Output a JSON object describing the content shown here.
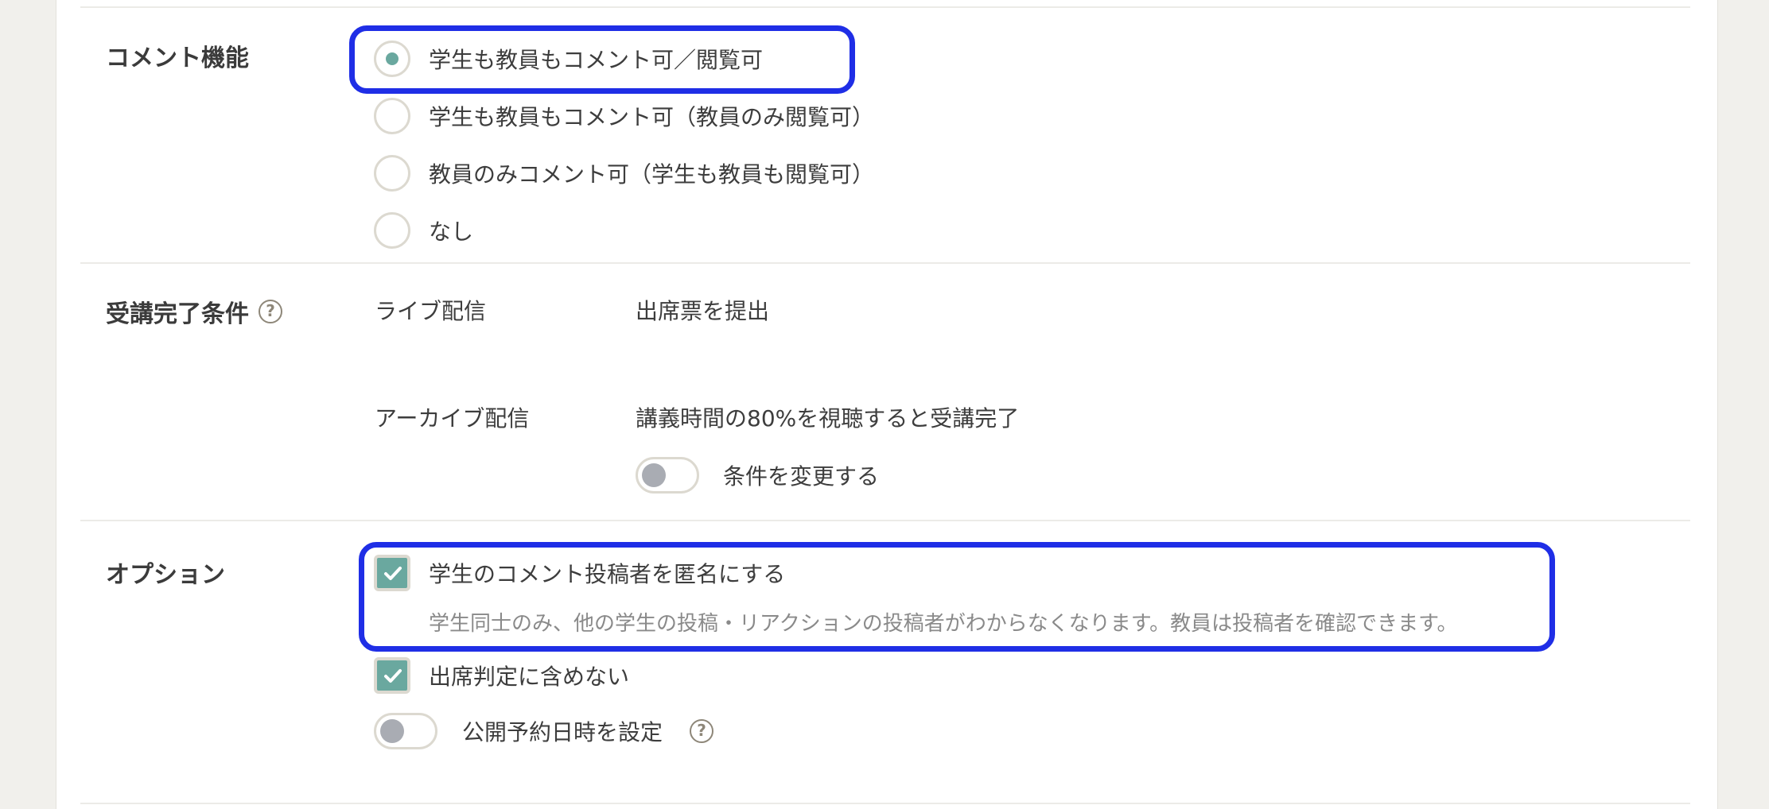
{
  "comment_section": {
    "title": "コメント機能",
    "options": [
      {
        "label": "学生も教員もコメント可／閲覧可",
        "checked": true
      },
      {
        "label": "学生も教員もコメント可（教員のみ閲覧可）",
        "checked": false
      },
      {
        "label": "教員のみコメント可（学生も教員も閲覧可）",
        "checked": false
      },
      {
        "label": "なし",
        "checked": false
      }
    ]
  },
  "completion_section": {
    "title": "受講完了条件",
    "help_icon": "help-circle-icon",
    "live_label": "ライブ配信",
    "live_value": "出席票を提出",
    "archive_label": "アーカイブ配信",
    "archive_value": "講義時間の80%を視聴すると受講完了",
    "toggle_label": "条件を変更する",
    "toggle_on": false
  },
  "options_section": {
    "title": "オプション",
    "anonymous_label": "学生のコメント投稿者を匿名にする",
    "anonymous_checked": true,
    "anonymous_desc": "学生同士のみ、他の学生の投稿・リアクションの投稿者がわからなくなります。教員は投稿者を確認できます。",
    "exclude_label": "出席判定に含めない",
    "exclude_checked": true,
    "schedule_label": "公開予約日時を設定",
    "schedule_on": false,
    "help_icon": "help-circle-icon"
  },
  "colors": {
    "accent": "#6aa89f",
    "highlight": "#1f2ee6",
    "toggle_knob": "#a9acb3",
    "border": "#dcd9d0"
  }
}
